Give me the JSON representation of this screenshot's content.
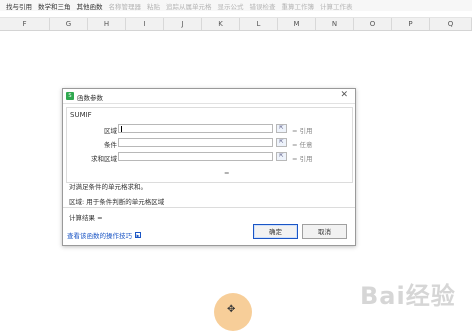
{
  "ribbon": {
    "items": [
      {
        "label": "找与引用",
        "dim": false
      },
      {
        "label": "数学和三角",
        "dim": false
      },
      {
        "label": "其他函数",
        "dim": false
      },
      {
        "label": "名称管理器",
        "dim": true
      },
      {
        "label": "粘贴",
        "dim": true
      },
      {
        "label": "追踪从属单元格",
        "dim": true
      },
      {
        "label": "显示公式",
        "dim": true
      },
      {
        "label": "错误检查",
        "dim": true
      },
      {
        "label": "重算工作簿",
        "dim": true
      },
      {
        "label": "计算工作表",
        "dim": true
      }
    ]
  },
  "columns": [
    "F",
    "G",
    "H",
    "I",
    "J",
    "K",
    "L",
    "M",
    "N",
    "O",
    "P",
    "Q"
  ],
  "dialog": {
    "title": "函数参数",
    "function_name": "SUMIF",
    "rows": [
      {
        "label": "区域",
        "value": "",
        "result": "= 引用"
      },
      {
        "label": "条件",
        "value": "",
        "result": "= 任意"
      },
      {
        "label": "求和区域",
        "value": "",
        "result": "= 引用"
      }
    ],
    "equals": "=",
    "description": "对满足条件的单元格求和。",
    "param_help": "区域:  用于条件判断的单元格区域",
    "result_label": "计算结果 =",
    "help_link": "查看该函数的操作技巧",
    "ok_label": "确定",
    "cancel_label": "取消"
  },
  "watermark": "Bai经验"
}
